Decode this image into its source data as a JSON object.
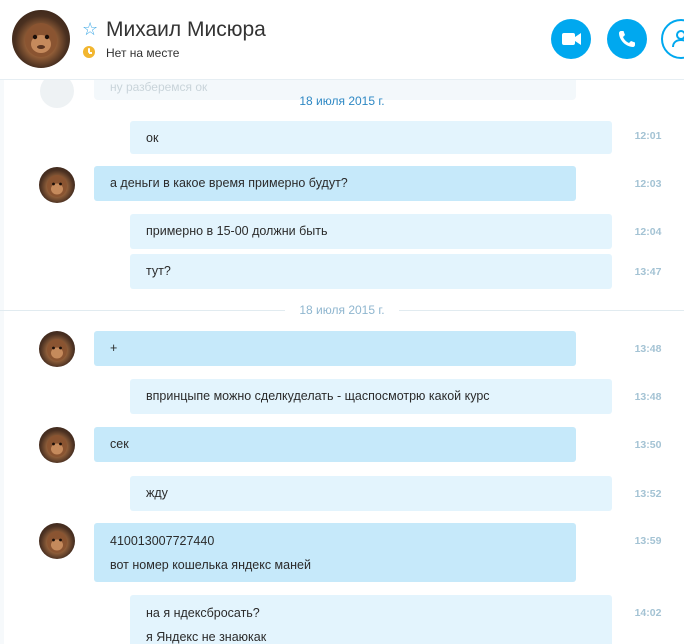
{
  "header": {
    "contact_name": "Михаил Мисюра",
    "status": "Нет на месте",
    "icons": {
      "favorite": "star-outline-icon",
      "status": "away-clock-icon",
      "video": "video-camera-icon",
      "call": "phone-icon",
      "add": "add-person-icon"
    },
    "colors": {
      "accent": "#00a8ef",
      "away": "#f2b630"
    }
  },
  "conversation": {
    "ghost_text": "ну разберемся ок",
    "dates": [
      "18 июля 2015 г.",
      "18 июля 2015 г."
    ],
    "messages": [
      {
        "from": "me",
        "text": "ок",
        "time": "12:01"
      },
      {
        "from": "contact",
        "text": "а деньги в какое время примерно будут?",
        "time": "12:03"
      },
      {
        "from": "me",
        "text": "примерно в 15-00 должни быть",
        "time": "12:04"
      },
      {
        "from": "me",
        "text": "тут?",
        "time": "13:47"
      },
      {
        "from": "contact",
        "text": "+",
        "time": "13:48"
      },
      {
        "from": "me",
        "text": "впринцыпе можно сделкуделать - щаспосмотрю какой курс",
        "time": "13:48"
      },
      {
        "from": "contact",
        "text": "сек",
        "time": "13:50"
      },
      {
        "from": "me",
        "text": "жду",
        "time": "13:52"
      },
      {
        "from": "contact",
        "lines": [
          "410013007727440",
          "вот номер кошелька яндекс маней"
        ],
        "time": "13:59"
      },
      {
        "from": "me",
        "lines": [
          "на я ндексбросать?",
          "я Яндекс не  знаюкак"
        ],
        "time": "14:02"
      }
    ],
    "colors": {
      "incoming_bubble": "#c6e9fa",
      "outgoing_bubble": "#e3f4fd",
      "time": "#a4c3d4"
    }
  }
}
